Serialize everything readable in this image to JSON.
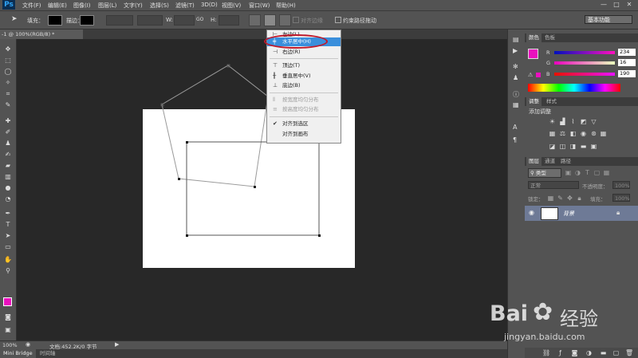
{
  "menubar": {
    "logo": "Ps",
    "items": [
      "文件(F)",
      "编辑(E)",
      "图像(I)",
      "图层(L)",
      "文字(Y)",
      "选择(S)",
      "滤镜(T)",
      "3D(D)",
      "视图(V)",
      "窗口(W)",
      "帮助(H)"
    ],
    "window_buttons": [
      "—",
      "□",
      "✕"
    ]
  },
  "options": {
    "fill_label": "填充：",
    "stroke_label": "描边：",
    "w_label": "W:",
    "h_label": "H:",
    "go_label": "GO",
    "align_edges_label": "对齐边缘",
    "constrain_label": "约束路径拖动",
    "workspace": "基本功能"
  },
  "document": {
    "tab_title": "-1 @ 100%(RGB/8) *"
  },
  "align_menu": {
    "items": [
      {
        "label": "左边(L)",
        "icon": "⊢",
        "state": "normal"
      },
      {
        "label": "水平居中(H)",
        "icon": "╪",
        "state": "selected"
      },
      {
        "label": "右边(R)",
        "icon": "⊣",
        "state": "normal"
      },
      {
        "label": "顶边(T)",
        "icon": "⊤",
        "state": "normal"
      },
      {
        "label": "垂直居中(V)",
        "icon": "╫",
        "state": "normal"
      },
      {
        "label": "底边(B)",
        "icon": "⊥",
        "state": "normal"
      },
      {
        "label": "按宽度均匀分布",
        "icon": "⫴",
        "state": "disabled"
      },
      {
        "label": "按高度均匀分布",
        "icon": "≡",
        "state": "disabled"
      },
      {
        "label": "对齐到选区",
        "icon": "✔",
        "state": "normal"
      },
      {
        "label": "对齐到画布",
        "icon": "",
        "state": "normal"
      }
    ]
  },
  "status": {
    "zoom": "100%",
    "doc_info": "文档:452.2K/0 字节"
  },
  "bottom_tabs": [
    "Mini Bridge",
    "时间轴"
  ],
  "color_panel": {
    "tabs": [
      "颜色",
      "色板"
    ],
    "r_label": "R",
    "g_label": "G",
    "b_label": "B",
    "r": "234",
    "g": "16",
    "b": "190",
    "foreground": "#ea10be"
  },
  "adjust_panel": {
    "tabs": [
      "调整",
      "样式"
    ],
    "title": "添加调整"
  },
  "layers_panel": {
    "tabs": [
      "图层",
      "通道",
      "路径"
    ],
    "kind_label": "类型",
    "blend_mode": "正常",
    "opacity_label": "不透明度：",
    "opacity": "100%",
    "lock_label": "锁定：",
    "fill_label": "填充：",
    "fill": "100%",
    "layer_name": "背景"
  },
  "watermark": {
    "brand": "Bai",
    "brand2": "经验",
    "url": "jingyan.baidu.com"
  },
  "colors": {
    "accent": "#3a8fdc",
    "highlight": "#c0192a"
  }
}
